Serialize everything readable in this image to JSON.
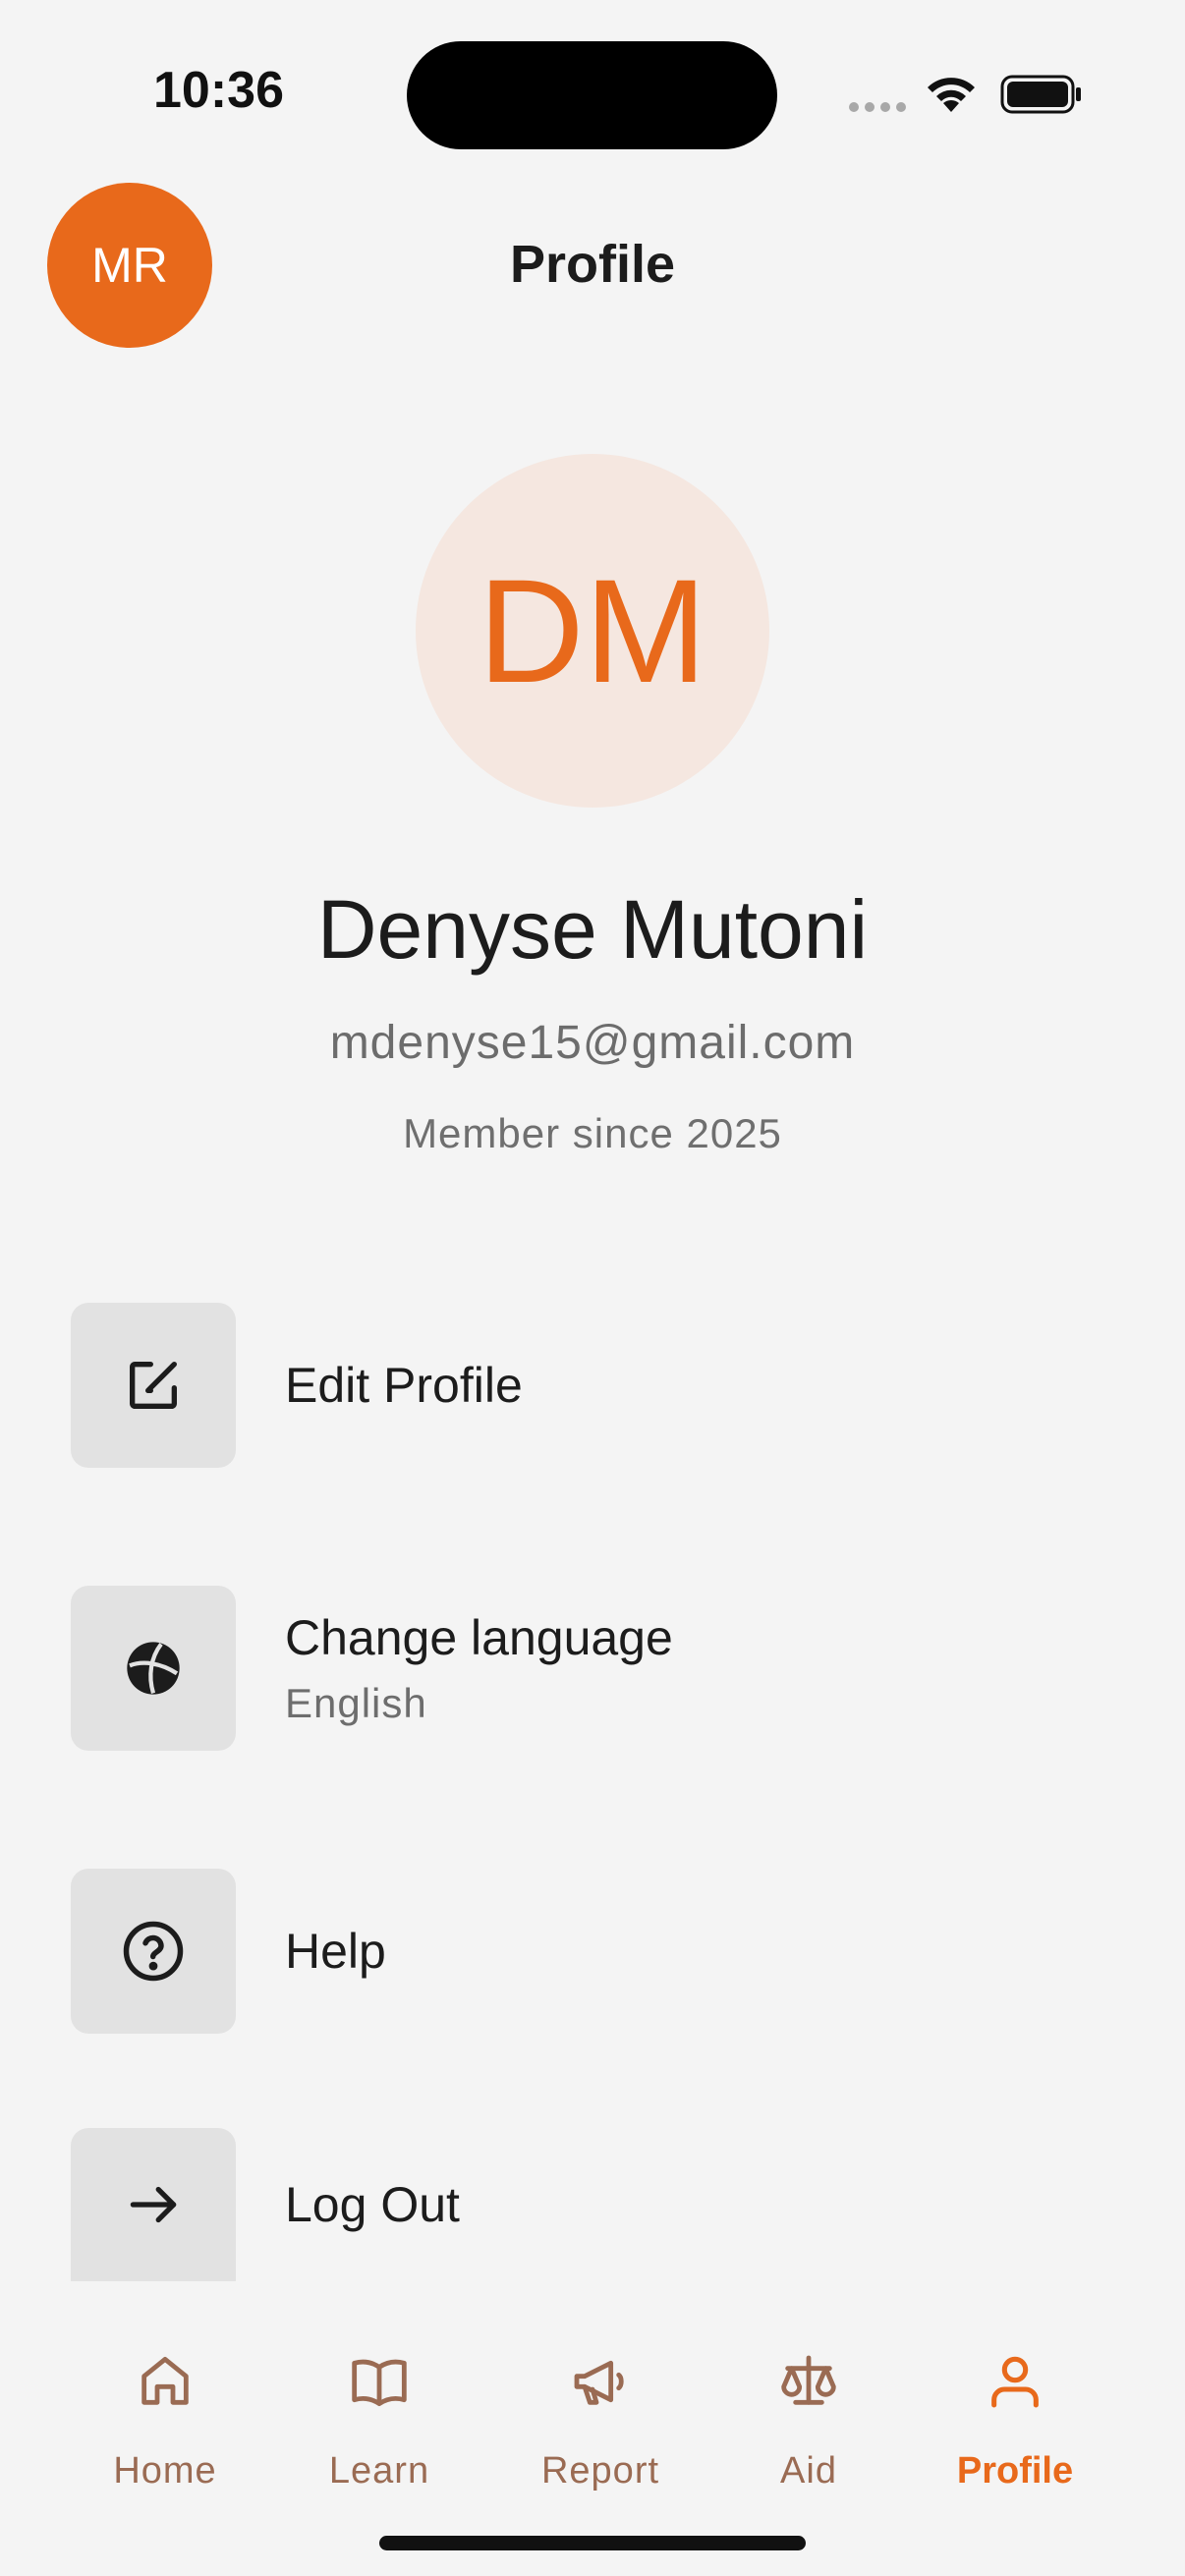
{
  "status_bar": {
    "time": "10:36"
  },
  "header": {
    "user_initials": "MR",
    "title": "Profile"
  },
  "profile": {
    "avatar_initials": "DM",
    "name": "Denyse Mutoni",
    "email": "mdenyse15@gmail.com",
    "member_since": "Member since 2025"
  },
  "menu": {
    "edit_profile": {
      "label": "Edit Profile",
      "icon": "edit-icon"
    },
    "change_language": {
      "label": "Change language",
      "value": "English",
      "icon": "globe-icon"
    },
    "help": {
      "label": "Help",
      "icon": "help-icon"
    },
    "log_out": {
      "label": "Log Out",
      "icon": "arrow-right-icon"
    }
  },
  "bottom_nav": {
    "home": "Home",
    "learn": "Learn",
    "report": "Report",
    "aid": "Aid",
    "profile": "Profile",
    "active": "profile"
  },
  "colors": {
    "accent": "#e8691b",
    "avatar_bg": "#f5e7e0",
    "nav_inactive": "#9a6b53",
    "background": "#f4f4f4"
  }
}
